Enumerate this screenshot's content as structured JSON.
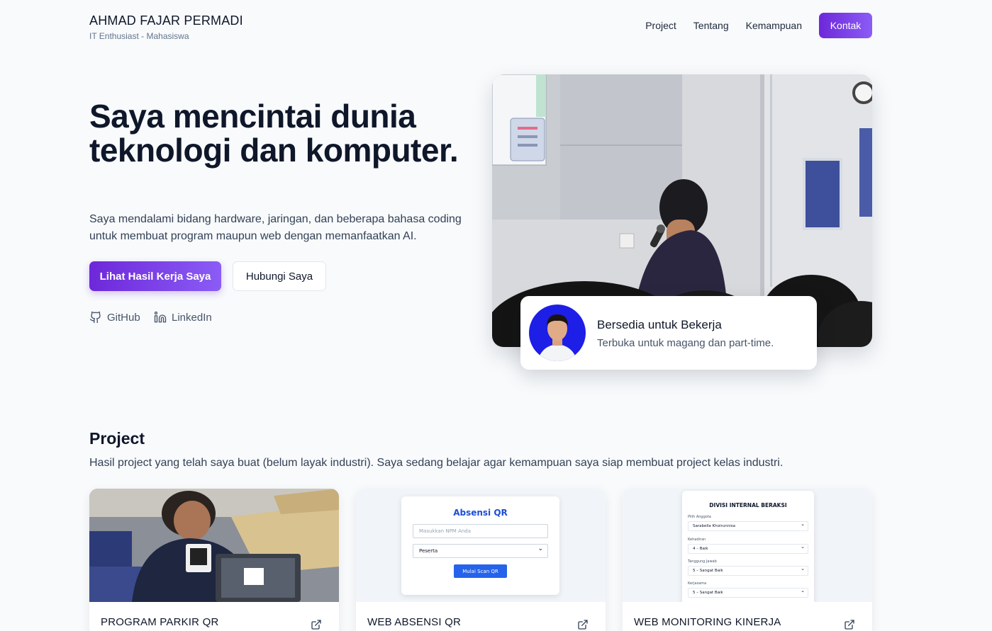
{
  "header": {
    "name": "AHMAD FAJAR PERMADI",
    "tagline": "IT Enthusiast - Mahasiswa",
    "nav": [
      "Project",
      "Tentang",
      "Kemampuan"
    ],
    "cta": "Kontak"
  },
  "hero": {
    "title": "Saya mencintai dunia teknologi dan komputer.",
    "description": "Saya mendalami bidang hardware, jaringan, dan beberapa bahasa coding untuk membuat program maupun web dengan memanfaatkan AI.",
    "primary_button": "Lihat Hasil Kerja Saya",
    "secondary_button": "Hubungi Saya",
    "social": [
      {
        "label": "GitHub",
        "icon": "github-icon"
      },
      {
        "label": "LinkedIn",
        "icon": "linkedin-icon"
      }
    ]
  },
  "availability": {
    "title": "Bersedia untuk Bekerja",
    "subtitle": "Terbuka untuk magang dan part-time."
  },
  "projects": {
    "title": "Project",
    "description": "Hasil project yang telah saya buat (belum layak industri). Saya sedang belajar agar kemampuan saya siap membuat project kelas industri.",
    "items": [
      {
        "title": "PROGRAM PARKIR QR",
        "icon": "external-link-icon"
      },
      {
        "title": "WEB ABSENSI QR",
        "icon": "external-link-icon"
      },
      {
        "title": "WEB MONITORING KINERJA",
        "icon": "external-link-icon"
      }
    ],
    "absensi_preview": {
      "title": "Absensi QR",
      "placeholder": "Masukkan NPM Anda",
      "select": "Peserta",
      "button": "Mulai Scan QR"
    },
    "monitoring_preview": {
      "title": "DIVISI INTERNAL BERAKSI",
      "fields": [
        {
          "label": "Pilih Anggota",
          "value": "Sarabella Khoirunnisa"
        },
        {
          "label": "Kehadiran",
          "value": "4 – Baik"
        },
        {
          "label": "Tanggung Jawab",
          "value": "5 – Sangat Baik"
        },
        {
          "label": "Kerjasama",
          "value": "5 – Sangat Baik"
        }
      ]
    }
  },
  "colors": {
    "accent_start": "#6d28d9",
    "accent_end": "#8b5cf6",
    "background": "#f8fafc",
    "text": "#0f172a"
  }
}
